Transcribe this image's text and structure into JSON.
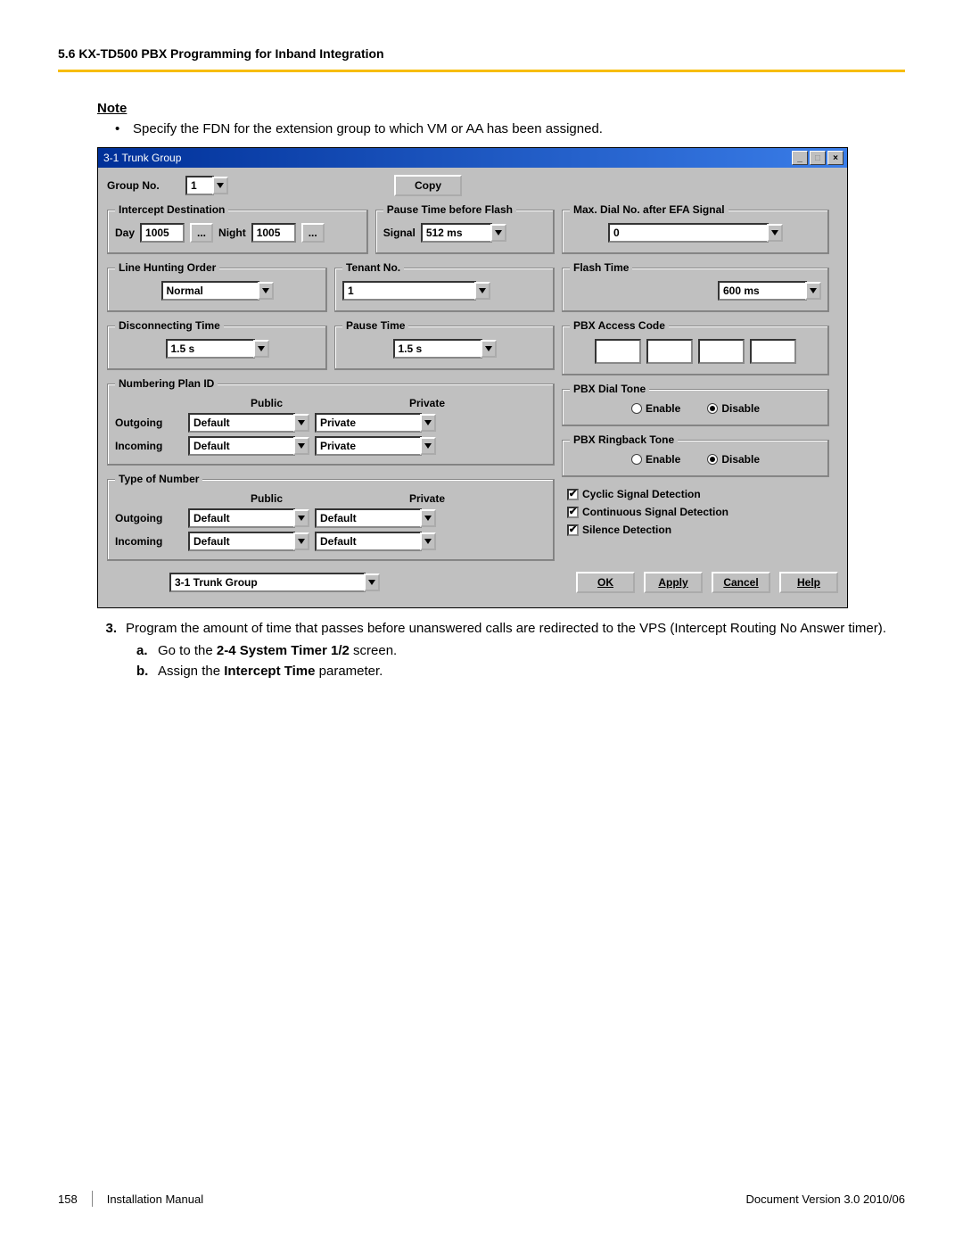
{
  "header": "5.6 KX-TD500 PBX Programming for Inband Integration",
  "note": {
    "title": "Note",
    "bullet1_pre": "Specify the FDN for the extension group to which VM or AA has been assigned."
  },
  "step3": {
    "num": "3.",
    "text": "Program the amount of time that passes before unanswered calls are redirected to the VPS (Intercept Routing No Answer timer).",
    "a_id": "a.",
    "a_pre": "Go to the ",
    "a_bold": "2-4 System Timer 1/2 ",
    "a_post": "screen.",
    "b_id": "b.",
    "b_pre": "Assign the ",
    "b_bold": "Intercept Time ",
    "b_post": "parameter."
  },
  "footer": {
    "page": "158",
    "title": "Installation Manual",
    "ver": "Document Version  3.0  2010/06"
  },
  "win": {
    "title": "3-1 Trunk Group",
    "group_no_lbl": "Group No.",
    "group_no_val": "1",
    "copy_btn": "Copy",
    "intercept": {
      "legend": "Intercept Destination",
      "day_lbl": "Day",
      "day_val": "1005",
      "night_lbl": "Night",
      "night_val": "1005",
      "dots": "..."
    },
    "pause_flash": {
      "legend": "Pause Time before Flash",
      "signal_lbl": "Signal",
      "signal_val": "512 ms"
    },
    "max_dial": {
      "legend": "Max. Dial No. after EFA Signal",
      "val": "0"
    },
    "line_hunt": {
      "legend": "Line Hunting Order",
      "val": "Normal"
    },
    "tenant": {
      "legend": "Tenant No.",
      "val": "1"
    },
    "flash_time": {
      "legend": "Flash Time",
      "val": "600 ms"
    },
    "disc_time": {
      "legend": "Disconnecting Time",
      "val": "1.5 s"
    },
    "pause_time": {
      "legend": "Pause Time",
      "val": "1.5 s"
    },
    "pbx_access": {
      "legend": "PBX Access Code",
      "v1": "",
      "v2": "",
      "v3": "",
      "v4": ""
    },
    "np": {
      "legend": "Numbering Plan ID",
      "pub_h": "Public",
      "priv_h": "Private",
      "out_lbl": "Outgoing",
      "in_lbl": "Incoming",
      "out_pub": "Default",
      "out_priv": "Private",
      "in_pub": "Default",
      "in_priv": "Private"
    },
    "ton": {
      "legend": "Type of Number",
      "pub_h": "Public",
      "priv_h": "Private",
      "out_lbl": "Outgoing",
      "in_lbl": "Incoming",
      "out_pub": "Default",
      "out_priv": "Default",
      "in_pub": "Default",
      "in_priv": "Default"
    },
    "dial_tone": {
      "legend": "PBX Dial Tone",
      "en": "Enable",
      "dis": "Disable",
      "sel": "Disable"
    },
    "ring_tone": {
      "legend": "PBX Ringback Tone",
      "en": "Enable",
      "dis": "Disable",
      "sel": "Disable"
    },
    "checks": {
      "c1": "Cyclic Signal Detection",
      "c2": "Continuous Signal Detection",
      "c3": "Silence Detection"
    },
    "bottom": {
      "combo": "3-1 Trunk Group",
      "ok": "OK",
      "apply": "Apply",
      "cancel": "Cancel",
      "help": "Help"
    }
  }
}
